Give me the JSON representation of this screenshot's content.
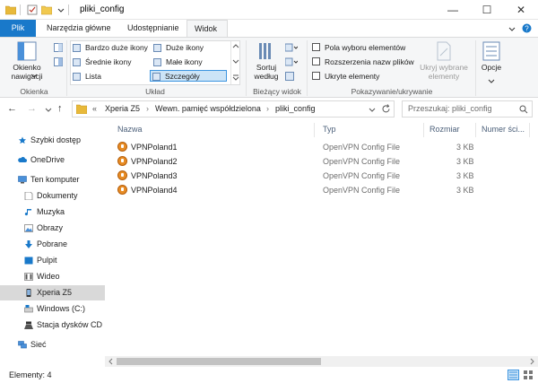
{
  "window": {
    "title": "pliki_config",
    "minimize": "—",
    "maximize": "☐",
    "close": "✕"
  },
  "tabs": [
    {
      "label": "Plik"
    },
    {
      "label": "Narzędzia główne"
    },
    {
      "label": "Udostępnianie"
    },
    {
      "label": "Widok"
    }
  ],
  "ribbon": {
    "panes": {
      "nav_pane_label": "Okienko nawigacji",
      "group_label": "Okienka"
    },
    "layout": {
      "items": [
        "Bardzo duże ikony",
        "Duże ikony",
        "Średnie ikony",
        "Małe ikony",
        "Lista",
        "Szczegóły"
      ],
      "selected": "Szczegóły",
      "group_label": "Układ"
    },
    "current_view": {
      "sort_label": "Sortuj według",
      "group_label": "Bieżący widok"
    },
    "show_hide": {
      "checkboxes": [
        "Pola wyboru elementów",
        "Rozszerzenia nazw plików",
        "Ukryte elementy"
      ],
      "hide_selected_label": "Ukryj wybrane elementy",
      "options_label": "Opcje",
      "group_label": "Pokazywanie/ukrywanie"
    }
  },
  "navbar": {
    "breadcrumb": [
      "«",
      "Xperia Z5",
      "Wewn. pamięć współdzielona",
      "pliki_config"
    ],
    "search_placeholder": "Przeszukaj: pliki_config"
  },
  "nav_pane": {
    "items": [
      {
        "label": "Szybki dostęp",
        "icon": "star-icon"
      },
      {
        "label": "OneDrive",
        "icon": "cloud-icon"
      },
      {
        "label": "Ten komputer",
        "icon": "computer-icon"
      },
      {
        "label": "Dokumenty",
        "icon": "document-icon"
      },
      {
        "label": "Muzyka",
        "icon": "music-icon"
      },
      {
        "label": "Obrazy",
        "icon": "pictures-icon"
      },
      {
        "label": "Pobrane",
        "icon": "download-icon"
      },
      {
        "label": "Pulpit",
        "icon": "desktop-icon"
      },
      {
        "label": "Wideo",
        "icon": "video-icon"
      },
      {
        "label": "Xperia Z5",
        "icon": "phone-icon",
        "selected": true
      },
      {
        "label": "Windows (C:)",
        "icon": "drive-icon"
      },
      {
        "label": "Stacja dysków CD (E",
        "icon": "cd-drive-icon"
      },
      {
        "label": "Sieć",
        "icon": "network-icon"
      }
    ]
  },
  "columns": [
    "Nazwa",
    "Typ",
    "Rozmiar",
    "Numer ści..."
  ],
  "files": [
    {
      "name": "VPNPoland1",
      "type": "OpenVPN Config File",
      "size": "3 KB"
    },
    {
      "name": "VPNPoland2",
      "type": "OpenVPN Config File",
      "size": "3 KB"
    },
    {
      "name": "VPNPoland3",
      "type": "OpenVPN Config File",
      "size": "3 KB"
    },
    {
      "name": "VPNPoland4",
      "type": "OpenVPN Config File",
      "size": "3 KB"
    }
  ],
  "status": {
    "item_count": "Elementy: 4"
  },
  "colors": {
    "accent": "#1979ca",
    "selected_row": "#d9d9d9",
    "file_icon": "#e78c25"
  }
}
